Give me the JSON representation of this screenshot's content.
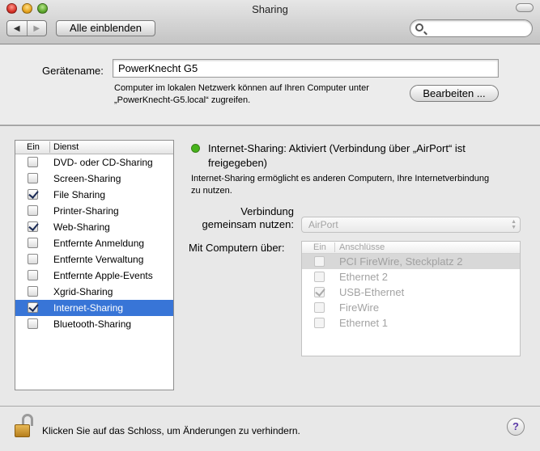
{
  "window": {
    "title": "Sharing"
  },
  "toolbar": {
    "back_icon": "◀",
    "forward_icon": "▶",
    "show_all_label": "Alle einblenden",
    "search": {
      "value": "",
      "placeholder": ""
    }
  },
  "device": {
    "name_label": "Gerätename:",
    "name_value": "PowerKnecht G5",
    "hint_line1": "Computer im lokalen Netzwerk können auf Ihren Computer unter",
    "hint_line2": "„PowerKnecht-G5.local“ zugreifen.",
    "edit_label": "Bearbeiten ..."
  },
  "services": {
    "header_on": "Ein",
    "header_service": "Dienst",
    "items": [
      {
        "label": "DVD- oder CD-Sharing",
        "checked": false,
        "selected": false
      },
      {
        "label": "Screen-Sharing",
        "checked": false,
        "selected": false
      },
      {
        "label": "File Sharing",
        "checked": true,
        "selected": false
      },
      {
        "label": "Printer-Sharing",
        "checked": false,
        "selected": false
      },
      {
        "label": "Web-Sharing",
        "checked": true,
        "selected": false
      },
      {
        "label": "Entfernte Anmeldung",
        "checked": false,
        "selected": false
      },
      {
        "label": "Entfernte Verwaltung",
        "checked": false,
        "selected": false
      },
      {
        "label": "Entfernte Apple-Events",
        "checked": false,
        "selected": false
      },
      {
        "label": "Xgrid-Sharing",
        "checked": false,
        "selected": false
      },
      {
        "label": "Internet-Sharing",
        "checked": true,
        "selected": true
      },
      {
        "label": "Bluetooth-Sharing",
        "checked": false,
        "selected": false
      }
    ]
  },
  "detail": {
    "status_color": "#46b31a",
    "status_line1": "Internet-Sharing: Aktiviert (Verbindung über „AirPort“ ist",
    "status_line2": "freigegeben)",
    "description_line1": "Internet-Sharing ermöglicht es anderen Computern, Ihre Internetverbindung",
    "description_line2": "zu nutzen.",
    "connection_label_line1": "Verbindung",
    "connection_label_line2": "gemeinsam nutzen:",
    "connection_value": "AirPort",
    "with_computers_label": "Mit Computern über:",
    "ports_header_on": "Ein",
    "ports_header_port": "Anschlüsse",
    "ports": [
      {
        "label": "PCI FireWire, Steckplatz 2",
        "checked": false,
        "selected": true
      },
      {
        "label": "Ethernet 2",
        "checked": false,
        "selected": false
      },
      {
        "label": "USB-Ethernet",
        "checked": true,
        "selected": false
      },
      {
        "label": "FireWire",
        "checked": false,
        "selected": false
      },
      {
        "label": "Ethernet 1",
        "checked": false,
        "selected": false
      }
    ]
  },
  "footer": {
    "lock_text": "Klicken Sie auf das Schloss, um Änderungen zu verhindern.",
    "help_label": "?"
  }
}
